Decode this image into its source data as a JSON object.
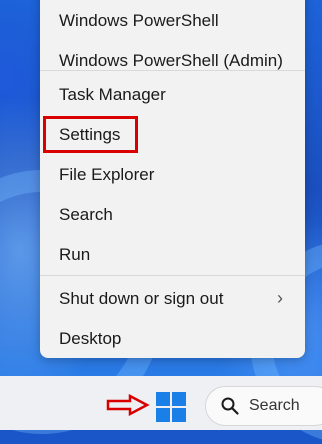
{
  "menu": {
    "items": [
      {
        "label": "Windows PowerShell"
      },
      {
        "label": "Windows PowerShell (Admin)"
      },
      {
        "label": "Task Manager"
      },
      {
        "label": "Settings"
      },
      {
        "label": "File Explorer"
      },
      {
        "label": "Search"
      },
      {
        "label": "Run"
      },
      {
        "label": "Shut down or sign out",
        "submenu": true
      },
      {
        "label": "Desktop"
      }
    ]
  },
  "taskbar": {
    "search_placeholder": "Search"
  },
  "colors": {
    "highlight": "#d90000",
    "start_icon": "#1a7fe6",
    "menu_bg": "#f2f2f2"
  }
}
